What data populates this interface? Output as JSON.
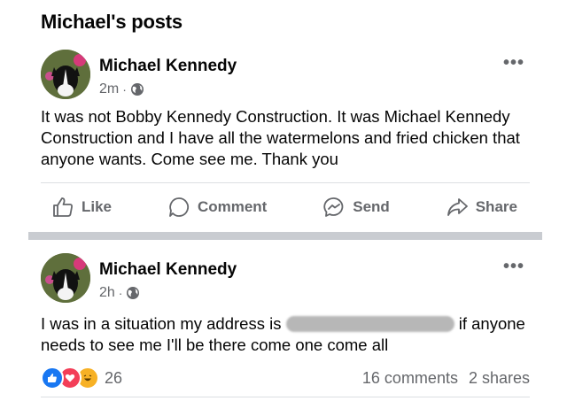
{
  "section": {
    "title": "Michael's posts"
  },
  "posts": [
    {
      "author": "Michael Kennedy",
      "time": "2m",
      "separator": "·",
      "more": "•••",
      "text": "It was not Bobby Kennedy Construction. It was Michael Kennedy Construction and I have all the watermelons and fried chicken that anyone wants. Come see me. Thank you",
      "actions": {
        "like": "Like",
        "comment": "Comment",
        "send": "Send",
        "share": "Share"
      }
    },
    {
      "author": "Michael Kennedy",
      "time": "2h",
      "separator": "·",
      "more": "•••",
      "text_before": "I was in a situation my address is ",
      "text_after": " if anyone needs to see me I'll be there come one come all",
      "reactions": {
        "count": "26",
        "comments": "16 comments",
        "shares": "2 shares"
      }
    }
  ],
  "colors": {
    "accent": "#1877f2",
    "secondary_text": "#65676b",
    "divider": "#c9ccd1"
  },
  "icons": {
    "privacy": "globe-icon",
    "like": "thumbs-up-icon",
    "comment": "comment-bubble-icon",
    "send": "messenger-icon",
    "share": "share-arrow-icon"
  }
}
